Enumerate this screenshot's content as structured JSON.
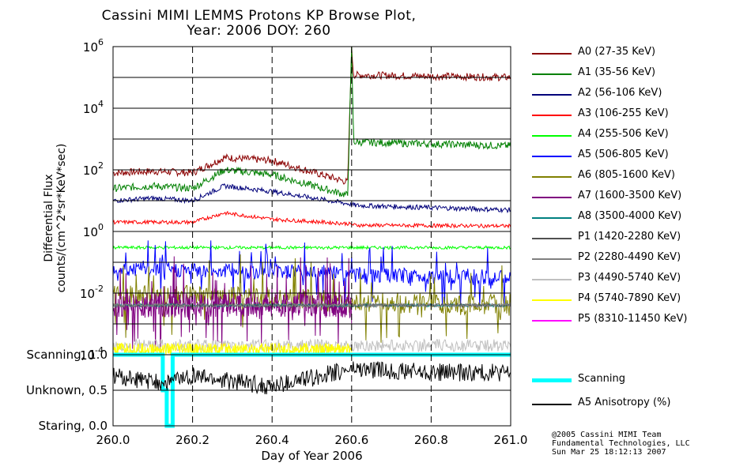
{
  "title": {
    "line1": "Cassini MIMI LEMMS Protons KP Browse Plot,",
    "line2": "Year: 2006 DOY: 260"
  },
  "chart_data": [
    {
      "type": "line",
      "title": "Cassini MIMI LEMMS Protons KP Browse Plot, Year: 2006 DOY: 260",
      "xlabel": "Day of Year 2006",
      "ylabel": [
        "Differential Flux",
        "counts/(cm^2*sr*KeV*sec)"
      ],
      "yscale": "log",
      "xlim": [
        260.0,
        261.0
      ],
      "ylim": [
        0.0001,
        1000000
      ],
      "yticks": [
        {
          "base": "10",
          "exp": "-4"
        },
        {
          "base": "10",
          "exp": "-2"
        },
        {
          "base": "10",
          "exp": "0"
        },
        {
          "base": "10",
          "exp": "2"
        },
        {
          "base": "10",
          "exp": "4"
        },
        {
          "base": "10",
          "exp": "6"
        }
      ],
      "grid": "dashed vertical at 0.2 day steps, solid horizontal at each decade",
      "legend_placement": "right",
      "series": [
        {
          "name": "A0 (27-35 KeV)",
          "color": "#8b0000",
          "x": [
            260.0,
            260.1,
            260.2,
            260.28,
            260.4,
            260.59,
            260.6,
            260.605,
            261.0
          ],
          "y": [
            80,
            90,
            80,
            250,
            200,
            40,
            800000,
            120000,
            100000
          ]
        },
        {
          "name": "A1 (35-56 KeV)",
          "color": "#008000",
          "x": [
            260.0,
            260.1,
            260.2,
            260.28,
            260.4,
            260.59,
            260.6,
            260.605,
            261.0
          ],
          "y": [
            25,
            30,
            25,
            100,
            70,
            15,
            1000000,
            800,
            600
          ]
        },
        {
          "name": "A2 (56-106 KeV)",
          "color": "#00007a",
          "x": [
            260.0,
            260.1,
            260.2,
            260.28,
            260.4,
            260.59,
            260.61,
            261.0
          ],
          "y": [
            10,
            12,
            10,
            30,
            20,
            8,
            7,
            5
          ]
        },
        {
          "name": "A3 (106-255 KeV)",
          "color": "#ff0000",
          "x": [
            260.0,
            260.2,
            260.28,
            260.4,
            260.59,
            260.61,
            261.0
          ],
          "y": [
            2,
            2,
            4,
            2.5,
            1.8,
            1.6,
            1.5
          ]
        },
        {
          "name": "A4 (255-506 KeV)",
          "color": "#00ff00",
          "x": [
            260.0,
            260.59,
            260.6,
            260.61,
            261.0
          ],
          "y": [
            0.3,
            0.3,
            0.3,
            0.3,
            0.3
          ]
        },
        {
          "name": "A5 (506-805 KeV)",
          "color": "#0000ff",
          "x": [
            260.0,
            260.5,
            260.6,
            261.0
          ],
          "y": [
            0.06,
            0.05,
            0.04,
            0.03
          ]
        },
        {
          "name": "A6 (805-1600 KeV)",
          "color": "#808000",
          "x": [
            260.0,
            260.3,
            260.6,
            261.0
          ],
          "y": [
            0.008,
            0.008,
            0.005,
            0.004
          ]
        },
        {
          "name": "A7 (1600-3500 KeV)",
          "color": "#800080",
          "x": [
            260.0,
            260.3,
            260.6
          ],
          "y": [
            0.004,
            0.004,
            0.004
          ]
        },
        {
          "name": "A8 (3500-4000 KeV)",
          "color": "#008080",
          "x": [
            260.0,
            261.0
          ],
          "y": [
            0.004,
            0.004
          ]
        },
        {
          "name": "P1 (1420-2280 KeV)",
          "color": "#505050",
          "x": [
            260.0,
            261.0
          ],
          "y": [
            0.004,
            0.004
          ]
        },
        {
          "name": "P2 (2280-4490 KeV)",
          "color": "#808080",
          "x": [
            260.0,
            261.0
          ],
          "y": [
            0.004,
            0.004
          ]
        },
        {
          "name": "P3 (4490-5740 KeV)",
          "color": "#c0c0c0",
          "x": [
            260.0,
            261.0
          ],
          "y": [
            0.0002,
            0.0002
          ]
        },
        {
          "name": "P4 (5740-7890 KeV)",
          "color": "#ffff00",
          "x": [
            260.0,
            260.6
          ],
          "y": [
            0.00015,
            0.00015
          ]
        },
        {
          "name": "P5 (8310-11450 KeV)",
          "color": "#ff00ff",
          "x": [],
          "y": []
        }
      ]
    },
    {
      "type": "line",
      "xlabel": "Day of Year 2006",
      "xlim": [
        260.0,
        261.0
      ],
      "ylim": [
        0.0,
        1.0
      ],
      "xticks": [
        "260.0",
        "260.2",
        "260.4",
        "260.6",
        "260.8",
        "261.0"
      ],
      "yticks": [
        "Staring, 0.0",
        "Unknown, 0.5",
        "Scanning, 1.0"
      ],
      "legend_placement": "right",
      "series": [
        {
          "name": "Scanning",
          "color": "#00ffff",
          "x": [
            260.0,
            260.125,
            260.125,
            260.135,
            260.135,
            260.15,
            260.15,
            261.0
          ],
          "y": [
            1.0,
            1.0,
            0.5,
            0.5,
            0.0,
            0.0,
            1.0,
            1.0
          ]
        },
        {
          "name": "A5 Anisotropy (%)",
          "color": "#000000",
          "x": [
            260.0,
            260.12,
            260.2,
            260.4,
            260.6,
            260.8,
            261.0
          ],
          "y": [
            0.7,
            0.6,
            0.7,
            0.55,
            0.8,
            0.75,
            0.75
          ]
        }
      ]
    }
  ],
  "legend": {
    "items": [
      {
        "label": "A0 (27-35 KeV)",
        "color": "#8b0000"
      },
      {
        "label": "A1 (35-56 KeV)",
        "color": "#008000"
      },
      {
        "label": "A2 (56-106 KeV)",
        "color": "#00007a"
      },
      {
        "label": "A3 (106-255 KeV)",
        "color": "#ff0000"
      },
      {
        "label": "A4 (255-506 KeV)",
        "color": "#00ff00"
      },
      {
        "label": "A5 (506-805 KeV)",
        "color": "#0000ff"
      },
      {
        "label": "A6 (805-1600 KeV)",
        "color": "#808000"
      },
      {
        "label": "A7 (1600-3500 KeV)",
        "color": "#800080"
      },
      {
        "label": "A8 (3500-4000 KeV)",
        "color": "#008080"
      },
      {
        "label": "P1 (1420-2280 KeV)",
        "color": "#505050"
      },
      {
        "label": "P2 (2280-4490 KeV)",
        "color": "#808080"
      },
      {
        "label": "P3 (4490-5740 KeV)",
        "color": "#c0c0c0"
      },
      {
        "label": "P4 (5740-7890 KeV)",
        "color": "#ffff00"
      },
      {
        "label": "P5 (8310-11450 KeV)",
        "color": "#ff00ff"
      }
    ],
    "lower": [
      {
        "label": "Scanning",
        "color": "#00ffff"
      },
      {
        "label": "A5 Anisotropy (%)",
        "color": "#000000"
      }
    ]
  },
  "credits": {
    "line1": "@2005 Cassini MIMI Team",
    "line2": "Fundamental Technologies, LLC",
    "line3": "Sun Mar 25 18:12:13 2007"
  }
}
